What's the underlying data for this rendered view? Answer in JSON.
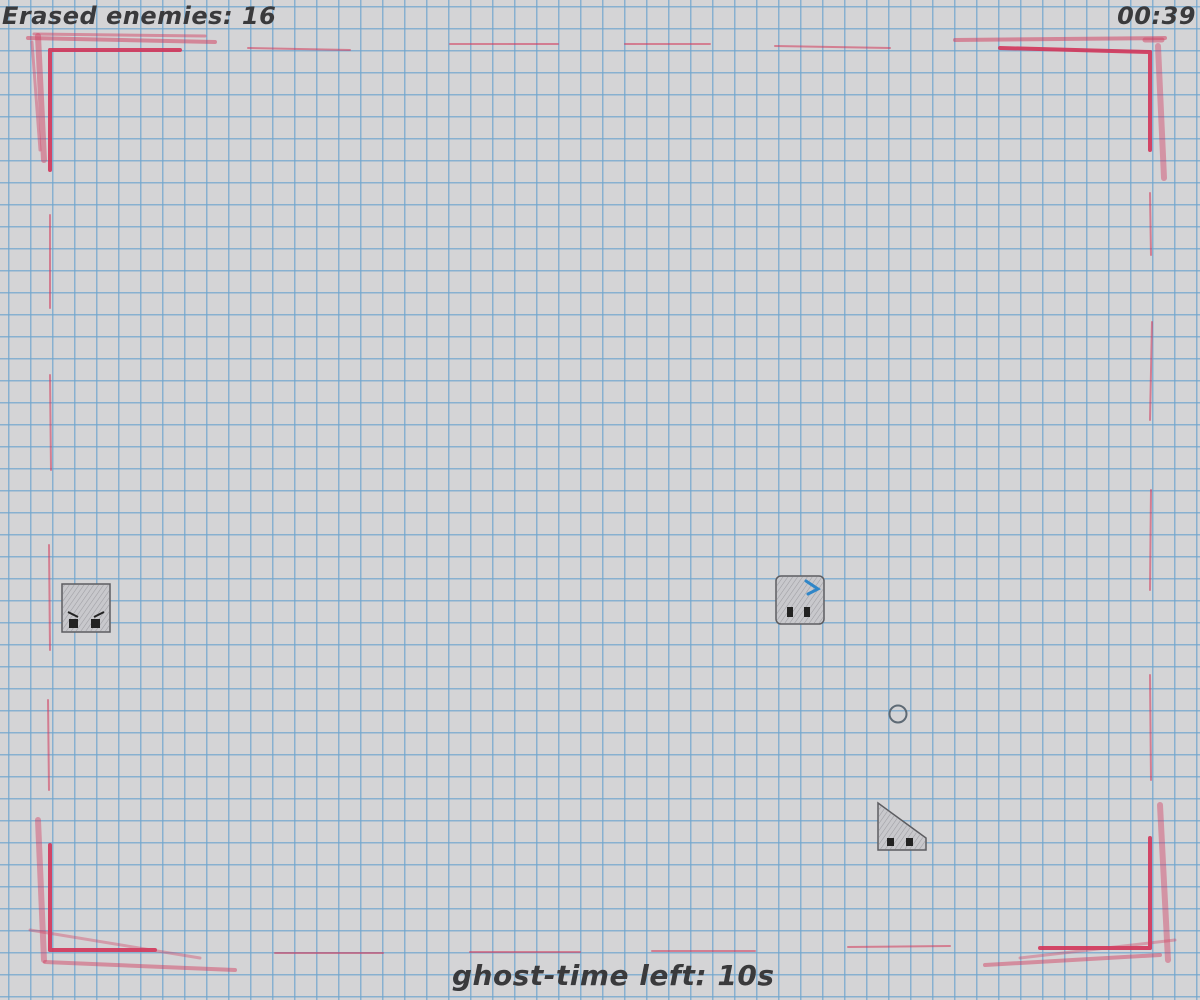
{
  "hud": {
    "score_label": "Erased enemies: 16",
    "timer": "00:39",
    "ghost_time": "ghost-time left: 10s"
  },
  "colors": {
    "paper": "#d4d4d6",
    "grid_line": "#6ea5cd",
    "border_red": "#d2365a",
    "hud_text": "#3a3a3c",
    "accent_blue": "#2f86c8"
  },
  "entities": [
    {
      "name": "enemy-square-angry",
      "kind": "square"
    },
    {
      "name": "player-square",
      "kind": "square"
    },
    {
      "name": "enemy-triangle",
      "kind": "triangle"
    },
    {
      "name": "aim-cursor",
      "kind": "circle"
    }
  ]
}
